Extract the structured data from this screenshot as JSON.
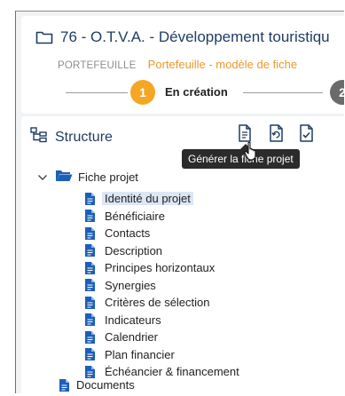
{
  "header": {
    "title": "76 - O.T.V.A. - Développement touristiqu",
    "breadcrumb_root": "PORTEFEUILLE",
    "breadcrumb_current": "Portefeuille - modèle de fiche",
    "step_number": "1",
    "step_label": "En création",
    "next_step_number": "2"
  },
  "structure": {
    "title": "Structure",
    "tooltip": "Générer la fiche projet",
    "root_label": "Fiche projet",
    "items": [
      {
        "label": "Identité du projet"
      },
      {
        "label": "Bénéficiaire"
      },
      {
        "label": "Contacts"
      },
      {
        "label": "Description"
      },
      {
        "label": "Principes horizontaux"
      },
      {
        "label": "Synergies"
      },
      {
        "label": "Critères de sélection"
      },
      {
        "label": "Indicateurs"
      },
      {
        "label": "Calendrier"
      },
      {
        "label": "Plan financier"
      },
      {
        "label": "Échéancier & financement"
      }
    ],
    "documents_label": "Documents"
  },
  "colors": {
    "accent_orange": "#f5a623",
    "title_blue": "#1f3d63",
    "icon_blue": "#1c5fb8",
    "selected_bg": "#dce6f5"
  }
}
